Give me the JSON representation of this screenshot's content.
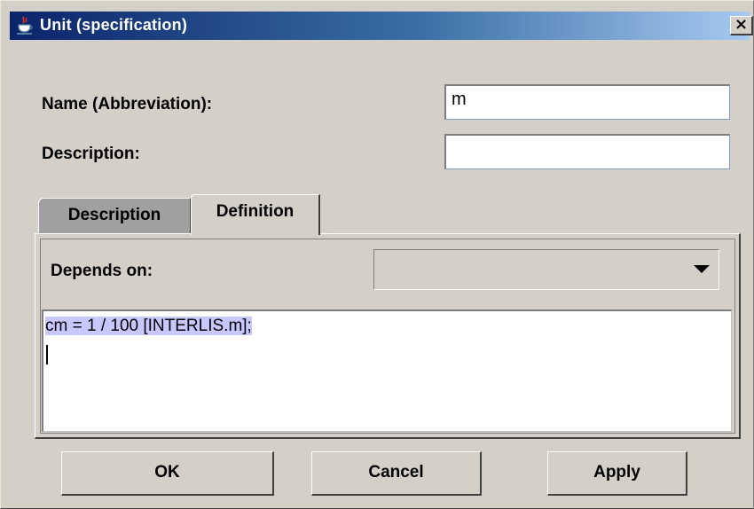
{
  "window": {
    "title": "Unit (specification)",
    "icon": "java-cup-icon",
    "close_label": "×"
  },
  "form": {
    "name_label": "Name (Abbreviation):",
    "name_value": "m",
    "description_label": "Description:",
    "description_value": ""
  },
  "tabs": [
    {
      "label": "Description",
      "selected": false
    },
    {
      "label": "Definition",
      "selected": true
    }
  ],
  "definition": {
    "depends_on_label": "Depends on:",
    "depends_on_value": "",
    "text": "cm = 1 / 100 [INTERLIS.m];"
  },
  "buttons": {
    "ok": "OK",
    "cancel": "Cancel",
    "apply": "Apply"
  },
  "colors": {
    "title_gradient_start": "#0a246a",
    "title_gradient_end": "#a6caf0",
    "selection": "#c8c8ff",
    "dialog_bg": "#d4d0c8"
  }
}
